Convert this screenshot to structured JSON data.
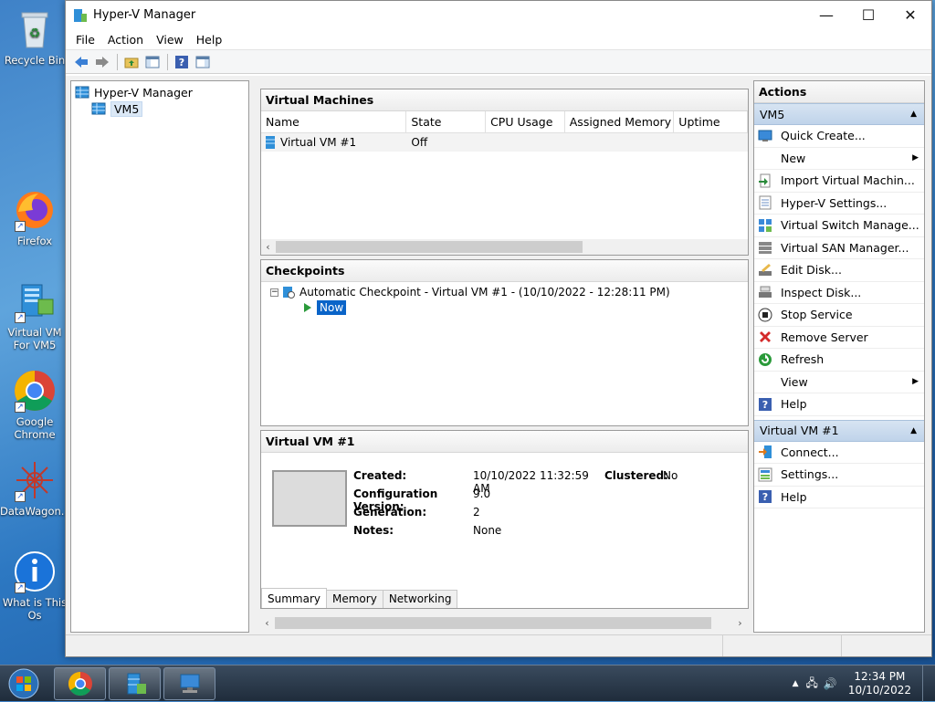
{
  "desktop": {
    "icons": [
      {
        "label": "Recycle Bin"
      },
      {
        "label": "Firefox"
      },
      {
        "label": "Virtual VM For VM5"
      },
      {
        "label": "Google Chrome"
      },
      {
        "label": "DataWagon..."
      },
      {
        "label": "What is This Os"
      }
    ]
  },
  "window": {
    "title": "Hyper-V Manager",
    "menu": [
      "File",
      "Action",
      "View",
      "Help"
    ],
    "controls": {
      "minimize": "—",
      "maximize": "☐",
      "close": "✕"
    }
  },
  "tree": {
    "root": "Hyper-V Manager",
    "child": "VM5"
  },
  "vm_pane": {
    "title": "Virtual Machines",
    "columns": [
      "Name",
      "State",
      "CPU Usage",
      "Assigned Memory",
      "Uptime"
    ],
    "rows": [
      {
        "name": "Virtual VM #1",
        "state": "Off",
        "cpu": "",
        "memory": "",
        "uptime": ""
      }
    ]
  },
  "checkpoints_pane": {
    "title": "Checkpoints",
    "checkpoint": "Automatic Checkpoint - Virtual VM #1 - (10/10/2022 - 12:28:11 PM)",
    "now": "Now"
  },
  "details_pane": {
    "title": "Virtual VM #1",
    "created_label": "Created:",
    "created_value": "10/10/2022 11:32:59 AM",
    "clustered_label": "Clustered:",
    "clustered_value": "No",
    "config_label": "Configuration Version:",
    "config_value": "9.0",
    "generation_label": "Generation:",
    "generation_value": "2",
    "notes_label": "Notes:",
    "notes_value": "None",
    "tabs": [
      "Summary",
      "Memory",
      "Networking"
    ]
  },
  "actions": {
    "title": "Actions",
    "group1": "VM5",
    "items1": [
      {
        "label": "Quick Create...",
        "icon": "quick-create-icon"
      },
      {
        "label": "New",
        "icon": "none",
        "submenu": true
      },
      {
        "label": "Import Virtual Machin...",
        "icon": "import-icon"
      },
      {
        "label": "Hyper-V Settings...",
        "icon": "settings-page-icon"
      },
      {
        "label": "Virtual Switch Manage...",
        "icon": "switch-icon"
      },
      {
        "label": "Virtual SAN Manager...",
        "icon": "san-icon"
      },
      {
        "label": "Edit Disk...",
        "icon": "edit-disk-icon"
      },
      {
        "label": "Inspect Disk...",
        "icon": "inspect-disk-icon"
      },
      {
        "label": "Stop Service",
        "icon": "stop-icon"
      },
      {
        "label": "Remove Server",
        "icon": "remove-icon"
      },
      {
        "label": "Refresh",
        "icon": "refresh-icon"
      },
      {
        "label": "View",
        "icon": "none",
        "submenu": true
      },
      {
        "label": "Help",
        "icon": "help-icon"
      }
    ],
    "group2": "Virtual VM #1",
    "items2": [
      {
        "label": "Connect...",
        "icon": "connect-icon"
      },
      {
        "label": "Settings...",
        "icon": "vm-settings-icon"
      },
      {
        "label": "Help",
        "icon": "help-icon"
      }
    ]
  },
  "taskbar": {
    "time": "12:34 PM",
    "date": "10/10/2022"
  }
}
